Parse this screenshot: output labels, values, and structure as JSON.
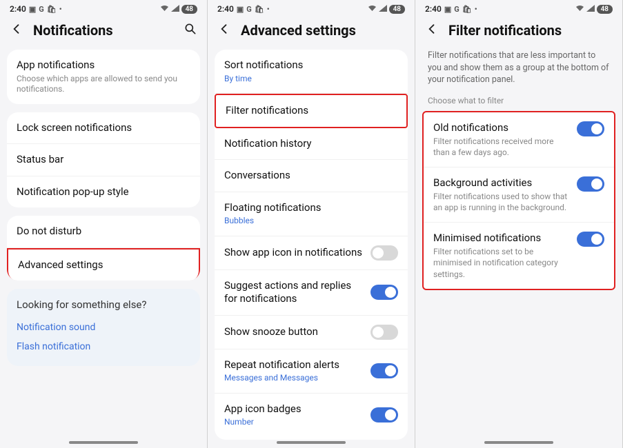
{
  "status": {
    "time": "2:40",
    "icons_left": [
      "image-icon",
      "g-icon",
      "bag-icon",
      "dot-icon"
    ],
    "battery": "48"
  },
  "screen1": {
    "title": "Notifications",
    "card1": {
      "title": "App notifications",
      "sub": "Choose which apps are allowed to send you notifications."
    },
    "card2": [
      "Lock screen notifications",
      "Status bar",
      "Notification pop-up style"
    ],
    "card3": [
      "Do not disturb",
      "Advanced settings"
    ],
    "help": {
      "title": "Looking for something else?",
      "links": [
        "Notification sound",
        "Flash notification"
      ]
    }
  },
  "screen2": {
    "title": "Advanced settings",
    "items": [
      {
        "title": "Sort notifications",
        "sub": "By time",
        "sub_blue": true
      },
      {
        "title": "Filter notifications",
        "highlight": true
      },
      {
        "title": "Notification history"
      },
      {
        "title": "Conversations"
      },
      {
        "title": "Floating notifications",
        "sub": "Bubbles",
        "sub_blue": true
      },
      {
        "title": "Show app icon in notifications",
        "toggle": "off"
      },
      {
        "title": "Suggest actions and replies for notifications",
        "toggle": "on"
      },
      {
        "title": "Show snooze button",
        "toggle": "off"
      },
      {
        "title": "Repeat notification alerts",
        "sub": "Messages and Messages",
        "sub_blue": true,
        "toggle": "on"
      },
      {
        "title": "App icon badges",
        "sub": "Number",
        "sub_blue": true,
        "toggle": "on"
      }
    ]
  },
  "screen3": {
    "title": "Filter notifications",
    "desc": "Filter notifications that are less important to you and show them as a group at the bottom of your notification panel.",
    "section": "Choose what to filter",
    "items": [
      {
        "title": "Old notifications",
        "sub": "Filter notifications received more than a few days ago.",
        "toggle": "on"
      },
      {
        "title": "Background activities",
        "sub": "Filter notifications used to show that an app is running in the background.",
        "toggle": "on"
      },
      {
        "title": "Minimised notifications",
        "sub": "Filter notifications set to be minimised in notification category settings.",
        "toggle": "on"
      }
    ]
  }
}
